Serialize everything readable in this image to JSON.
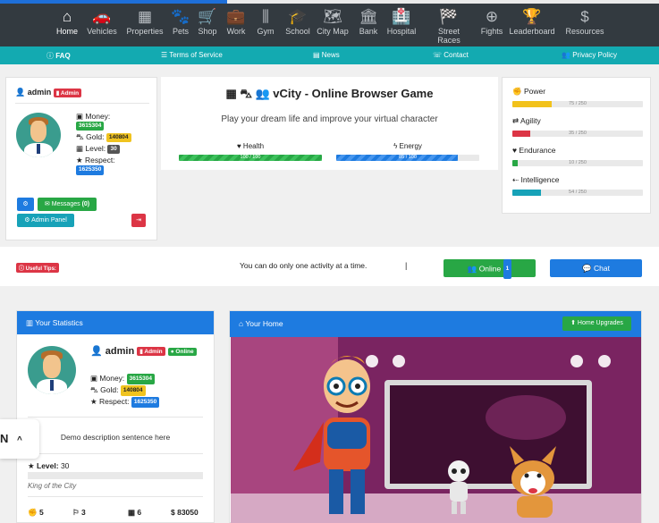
{
  "nav": {
    "items": [
      {
        "label": "Home",
        "icon": "home-icon",
        "glyph": "⌂"
      },
      {
        "label": "Vehicles",
        "icon": "car-icon",
        "glyph": "🚗"
      },
      {
        "label": "Properties",
        "icon": "building-icon",
        "glyph": "▦"
      },
      {
        "label": "Pets",
        "icon": "paw-icon",
        "glyph": "🐾"
      },
      {
        "label": "Shop",
        "icon": "cart-icon",
        "glyph": "🛒"
      },
      {
        "label": "Work",
        "icon": "briefcase-icon",
        "glyph": "💼"
      },
      {
        "label": "Gym",
        "icon": "dumbbell-icon",
        "glyph": "⫼"
      },
      {
        "label": "School",
        "icon": "graduation-cap-icon",
        "glyph": "🎓"
      },
      {
        "label": "City Map",
        "icon": "map-icon",
        "glyph": "🗺"
      },
      {
        "label": "Bank",
        "icon": "bank-icon",
        "glyph": "🏛"
      },
      {
        "label": "Hospital",
        "icon": "hospital-icon",
        "glyph": "🏥"
      },
      {
        "label": "Street Races",
        "icon": "checkered-flag-icon",
        "glyph": "🏁"
      },
      {
        "label": "Fights",
        "icon": "crosshairs-icon",
        "glyph": "⊕"
      },
      {
        "label": "Leaderboard",
        "icon": "trophy-icon",
        "glyph": "🏆"
      },
      {
        "label": "Resources",
        "icon": "dollar-icon",
        "glyph": "$"
      }
    ]
  },
  "subnav": {
    "faq": "FAQ",
    "terms": "Terms of Service",
    "news": "News",
    "contact": "Contact",
    "privacy": "Privacy Policy"
  },
  "profile": {
    "username": "admin",
    "role_badge": "Admin",
    "money_label": "Money:",
    "money": "3615304",
    "gold_label": "Gold:",
    "gold": "140804",
    "level_label": "Level:",
    "level": "30",
    "respect_label": "Respect:",
    "respect": "1625350",
    "messages_label": "Messages",
    "messages_count": "(0)",
    "admin_panel_label": "Admin Panel"
  },
  "header": {
    "title": "vCity - Online Browser Game",
    "subtitle": "Play your dream life and improve your virtual character",
    "health_label": "Health",
    "health_text": "100 / 100",
    "health_pct": 100,
    "energy_label": "Energy",
    "energy_text": "85 / 100",
    "energy_pct": 85
  },
  "skills": [
    {
      "label": "Power",
      "icon": "power-icon",
      "glyph": "✊",
      "text": "75 / 250",
      "pct": 30,
      "color": "#f2c21b"
    },
    {
      "label": "Agility",
      "icon": "retweet-icon",
      "glyph": "⇄",
      "text": "35 / 250",
      "pct": 14,
      "color": "#dc3545"
    },
    {
      "label": "Endurance",
      "icon": "heart-icon",
      "glyph": "♥",
      "text": "10 / 250",
      "pct": 4,
      "color": "#28a745"
    },
    {
      "label": "Intelligence",
      "icon": "usb-icon",
      "glyph": "⇠",
      "text": "54 / 250",
      "pct": 22,
      "color": "#17a2b8"
    }
  ],
  "tips": {
    "badge": "Useful Tips:",
    "text": "You can do only one activity at a time.",
    "divider": "|",
    "online_label": "Online",
    "online_count": "1",
    "chat_label": "Chat"
  },
  "stats": {
    "header": "Your Statistics",
    "username": "admin",
    "role_badge": "Admin",
    "online_badge": "Online",
    "money_label": "Money:",
    "money": "3615304",
    "gold_label": "Gold:",
    "gold": "140804",
    "respect_label": "Respect:",
    "respect": "1625350",
    "description": "Demo description sentence here",
    "level_label": "Level:",
    "level": "30",
    "rank": "King of the City",
    "footer": [
      {
        "icon": "power-icon",
        "glyph": "✊",
        "value": "5"
      },
      {
        "icon": "flag-icon",
        "glyph": "⚐",
        "value": "3"
      },
      {
        "icon": "building-icon",
        "glyph": "▦",
        "value": "6"
      },
      {
        "icon": "",
        "glyph": "",
        "value": "$ 83050"
      }
    ]
  },
  "home": {
    "header": "Your Home",
    "upgrades_label": "Home Upgrades"
  },
  "floating": {
    "letter": "N",
    "chevron": "^"
  }
}
